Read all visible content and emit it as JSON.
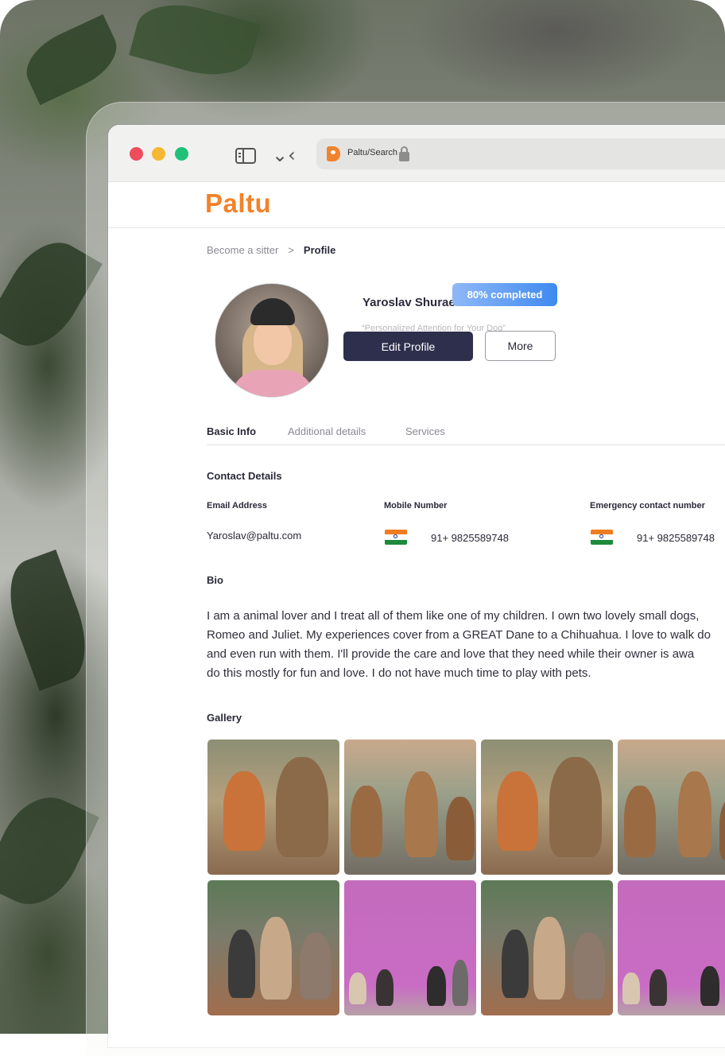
{
  "browser": {
    "url": "Paltu/Search"
  },
  "app": {
    "brand": "Paltu"
  },
  "breadcrumb": {
    "parent": "Become a sitter",
    "separator": ">",
    "current": "Profile"
  },
  "profile": {
    "name": "Yaroslav Shuraev",
    "completion_badge": "80% completed",
    "tagline": "“Personalized Attention for Your Dog”",
    "edit_button": "Edit Profile",
    "more_button": "More"
  },
  "tabs": [
    {
      "label": "Basic Info",
      "active": true
    },
    {
      "label": "Additional details",
      "active": false
    },
    {
      "label": "Services",
      "active": false
    }
  ],
  "contact": {
    "title": "Contact Details",
    "email_label": "Email Address",
    "email_value": "Yaroslav@paltu.com",
    "mobile_label": "Mobile Number",
    "mobile_value": "91+ 9825589748",
    "emergency_label": "Emergency contact number",
    "emergency_value": "91+ 9825589748"
  },
  "bio": {
    "title": "Bio",
    "lines": [
      "I am a animal lover and I treat all of them like one of my children. I own two lovely small dogs,",
      "Romeo and Juliet. My experiences cover from a GREAT Dane to a Chihuahua. I love to walk do",
      "and even run with them.  I'll provide the care and love that they need while their owner is awa",
      "do this mostly for fun and love. I do not have much time to play with pets."
    ]
  },
  "gallery": {
    "title": "Gallery",
    "photos": [
      "corgi-and-terrier",
      "three-puppies",
      "corgi-and-terrier",
      "three-puppies",
      "dogs-on-leash",
      "dogs-pink-wall",
      "dogs-on-leash",
      "dogs-pink-wall"
    ]
  },
  "colors": {
    "brand": "#f2822b",
    "primary_button": "#2d2f4d",
    "badge": "#3e8af0"
  }
}
